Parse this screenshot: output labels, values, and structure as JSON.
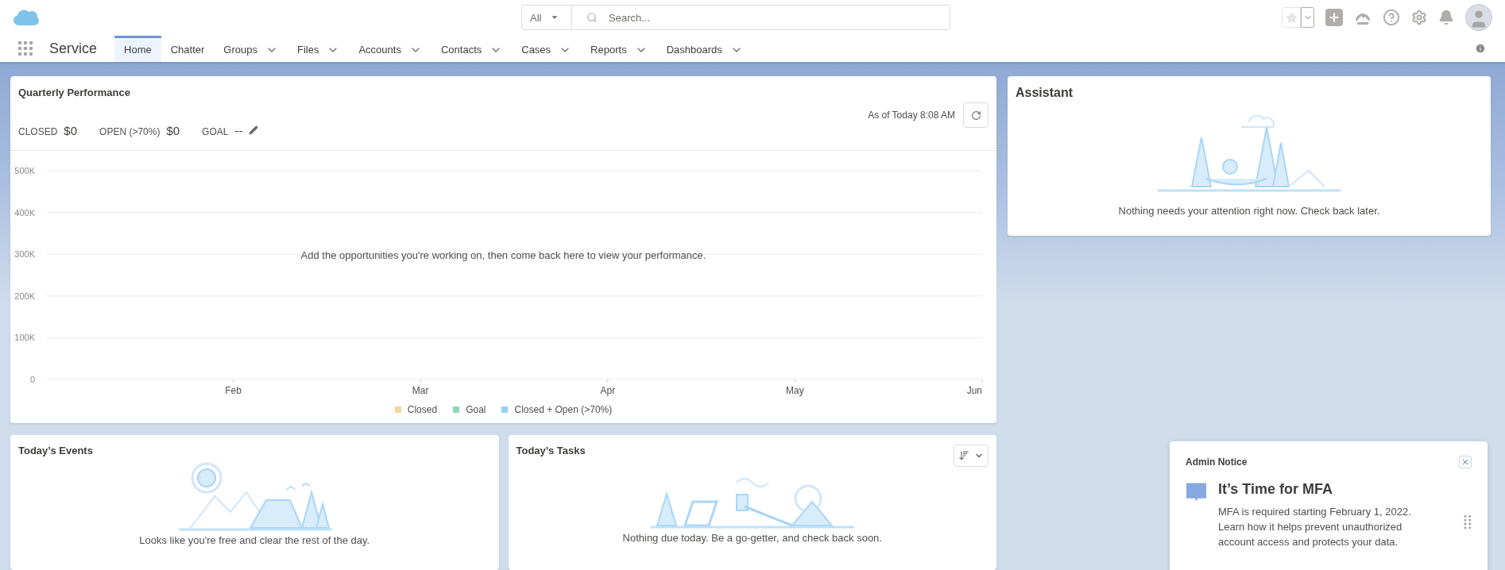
{
  "search": {
    "scope": "All",
    "placeholder": "Search..."
  },
  "app": {
    "name": "Service"
  },
  "nav_items": [
    {
      "label": "Home",
      "selected": true,
      "menu": false
    },
    {
      "label": "Chatter",
      "selected": false,
      "menu": false
    },
    {
      "label": "Groups",
      "selected": false,
      "menu": true
    },
    {
      "label": "Files",
      "selected": false,
      "menu": true
    },
    {
      "label": "Accounts",
      "selected": false,
      "menu": true
    },
    {
      "label": "Contacts",
      "selected": false,
      "menu": true
    },
    {
      "label": "Cases",
      "selected": false,
      "menu": true
    },
    {
      "label": "Reports",
      "selected": false,
      "menu": true
    },
    {
      "label": "Dashboards",
      "selected": false,
      "menu": true
    }
  ],
  "quarterly_performance": {
    "title": "Quarterly Performance",
    "as_of": "As of Today 8:08 AM",
    "metrics": [
      {
        "label": "CLOSED",
        "value": "$0",
        "editable": false
      },
      {
        "label": "OPEN (>70%)",
        "value": "$0",
        "editable": false
      },
      {
        "label": "GOAL",
        "value": "--",
        "editable": true
      }
    ],
    "empty_message": "Add the opportunities you're working on, then come back here to view your performance.",
    "chart_data": {
      "type": "line",
      "grid": true,
      "categories": [
        "Feb",
        "Mar",
        "Apr",
        "May",
        "Jun"
      ],
      "ylim": [
        0,
        500000
      ],
      "yticks": [
        {
          "value": 0,
          "label": "0"
        },
        {
          "value": 100000,
          "label": "100K"
        },
        {
          "value": 200000,
          "label": "200K"
        },
        {
          "value": 300000,
          "label": "300K"
        },
        {
          "value": 400000,
          "label": "400K"
        },
        {
          "value": 500000,
          "label": "500K"
        }
      ],
      "series": [
        {
          "name": "Closed",
          "color": "#f9d49b",
          "values": [
            null,
            null,
            null,
            null,
            null
          ]
        },
        {
          "name": "Goal",
          "color": "#8fd8b5",
          "values": [
            null,
            null,
            null,
            null,
            null
          ]
        },
        {
          "name": "Closed + Open (>70%)",
          "color": "#97d0ee",
          "values": [
            null,
            null,
            null,
            null,
            null
          ]
        }
      ]
    }
  },
  "assistant": {
    "title": "Assistant",
    "message": "Nothing needs your attention right now. Check back later."
  },
  "events": {
    "title": "Today’s Events",
    "message": "Looks like you're free and clear the rest of the day."
  },
  "tasks": {
    "title": "Today’s Tasks",
    "message": "Nothing due today. Be a go-getter, and check back soon."
  },
  "admin_notice": {
    "title": "Admin Notice",
    "heading": "It’s Time for MFA",
    "body": "MFA is required starting February 1, 2022. Learn how it helps prevent unauthorized account access and protects your data."
  }
}
